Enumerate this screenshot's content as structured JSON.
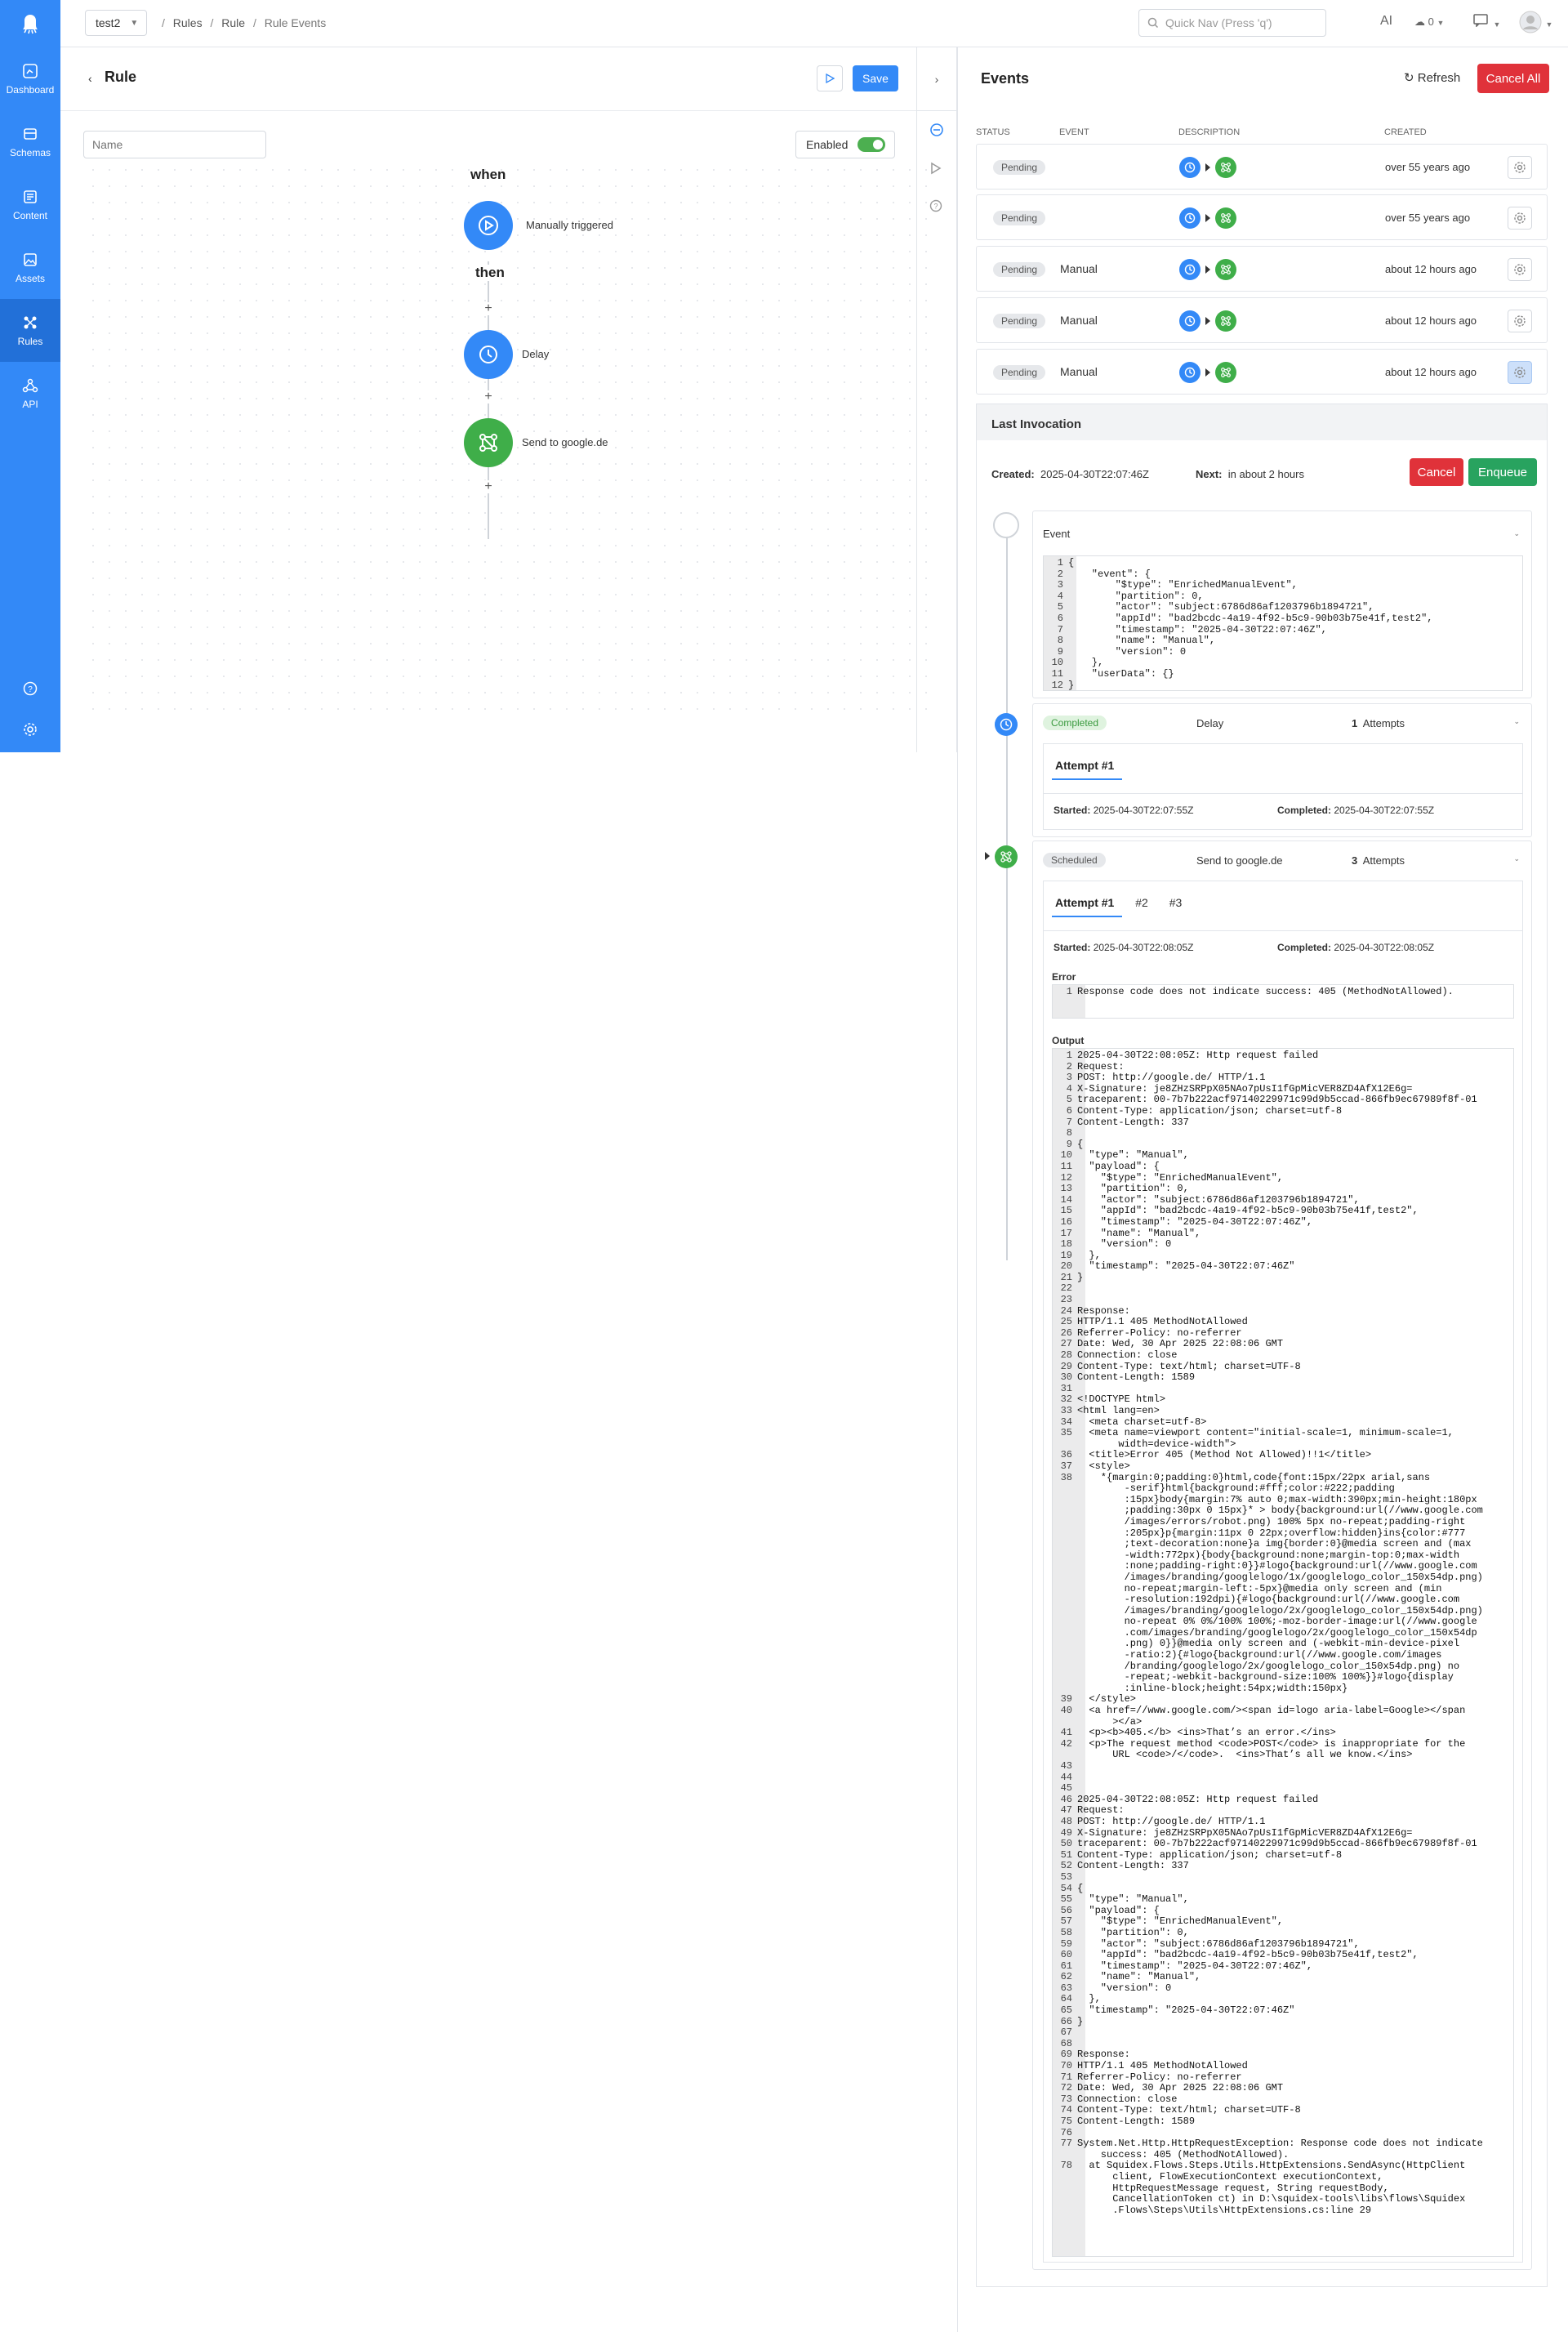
{
  "app": {
    "name": "test2"
  },
  "breadcrumb": [
    "Rules",
    "Rule",
    "Rule Events"
  ],
  "quicknav": {
    "placeholder": "Quick Nav (Press 'q')"
  },
  "topbar": {
    "ai_label": "AI",
    "upload_count": "0"
  },
  "nav": [
    {
      "label": "Dashboard"
    },
    {
      "label": "Schemas"
    },
    {
      "label": "Content"
    },
    {
      "label": "Assets"
    },
    {
      "label": "Rules"
    },
    {
      "label": "API"
    }
  ],
  "rule": {
    "title": "Rule",
    "save": "Save",
    "name_placeholder": "Name",
    "enabled_label": "Enabled",
    "when": "when",
    "then": "then",
    "trigger": "Manually triggered",
    "step1": "Delay",
    "step2": "Send to google.de",
    "plus": "+"
  },
  "events": {
    "title": "Events",
    "refresh": "Refresh",
    "cancel_all": "Cancel All",
    "columns": {
      "status": "STATUS",
      "event": "EVENT",
      "description": "DESCRIPTION",
      "created": "CREATED"
    },
    "rows": [
      {
        "status": "Pending",
        "event": "",
        "created": "over 55 years ago"
      },
      {
        "status": "Pending",
        "event": "",
        "created": "over 55 years ago"
      },
      {
        "status": "Pending",
        "event": "Manual",
        "created": "about 12 hours ago"
      },
      {
        "status": "Pending",
        "event": "Manual",
        "created": "about 12 hours ago"
      },
      {
        "status": "Pending",
        "event": "Manual",
        "created": "about 12 hours ago"
      }
    ]
  },
  "invocation": {
    "title": "Last Invocation",
    "created_label": "Created:",
    "created_value": "2025-04-30T22:07:46Z",
    "next_label": "Next:",
    "next_value": "in about 2 hours",
    "cancel": "Cancel",
    "enqueue": "Enqueue",
    "event_card_title": "Event",
    "event_json": [
      "{",
      "    \"event\": {",
      "        \"$type\": \"EnrichedManualEvent\",",
      "        \"partition\": 0,",
      "        \"actor\": \"subject:6786d86af1203796b1894721\",",
      "        \"appId\": \"bad2bcdc-4a19-4f92-b5c9-90b03b75e41f,test2\",",
      "        \"timestamp\": \"2025-04-30T22:07:46Z\",",
      "        \"name\": \"Manual\",",
      "        \"version\": 0",
      "    },",
      "    \"userData\": {}",
      "}"
    ],
    "step1": {
      "status": "Completed",
      "name": "Delay",
      "attempts_count": "1",
      "attempts_label": "Attempts",
      "tab": "Attempt  #1",
      "started_label": "Started:",
      "started": "2025-04-30T22:07:55Z",
      "completed_label": "Completed:",
      "completed": "2025-04-30T22:07:55Z"
    },
    "step2": {
      "status": "Scheduled",
      "name": "Send to google.de",
      "attempts_count": "3",
      "attempts_label": "Attempts",
      "tabs": [
        "Attempt  #1",
        "#2",
        "#3"
      ],
      "started_label": "Started:",
      "started": "2025-04-30T22:08:05Z",
      "completed_label": "Completed:",
      "completed": "2025-04-30T22:08:05Z",
      "error_label": "Error",
      "error": "Response code does not indicate success: 405 (MethodNotAllowed).",
      "output_label": "Output",
      "output": [
        [
          "1",
          "2025-04-30T22:08:05Z: Http request failed"
        ],
        [
          "2",
          "Request:"
        ],
        [
          "3",
          "POST: http://google.de/ HTTP/1.1"
        ],
        [
          "4",
          "X-Signature: je8ZHzSRPpX05NAo7pUsI1fGpMicVER8ZD4AfX12E6g="
        ],
        [
          "5",
          "traceparent: 00-7b7b222acf97140229971c99d9b5ccad-866fb9ec67989f8f-01"
        ],
        [
          "6",
          "Content-Type: application/json; charset=utf-8"
        ],
        [
          "7",
          "Content-Length: 337"
        ],
        [
          "8",
          ""
        ],
        [
          "9",
          "{"
        ],
        [
          "10",
          "  \"type\": \"Manual\","
        ],
        [
          "11",
          "  \"payload\": {"
        ],
        [
          "12",
          "    \"$type\": \"EnrichedManualEvent\","
        ],
        [
          "13",
          "    \"partition\": 0,"
        ],
        [
          "14",
          "    \"actor\": \"subject:6786d86af1203796b1894721\","
        ],
        [
          "15",
          "    \"appId\": \"bad2bcdc-4a19-4f92-b5c9-90b03b75e41f,test2\","
        ],
        [
          "16",
          "    \"timestamp\": \"2025-04-30T22:07:46Z\","
        ],
        [
          "17",
          "    \"name\": \"Manual\","
        ],
        [
          "18",
          "    \"version\": 0"
        ],
        [
          "19",
          "  },"
        ],
        [
          "20",
          "  \"timestamp\": \"2025-04-30T22:07:46Z\""
        ],
        [
          "21",
          "}"
        ],
        [
          "22",
          ""
        ],
        [
          "23",
          ""
        ],
        [
          "24",
          "Response:"
        ],
        [
          "25",
          "HTTP/1.1 405 MethodNotAllowed"
        ],
        [
          "26",
          "Referrer-Policy: no-referrer"
        ],
        [
          "27",
          "Date: Wed, 30 Apr 2025 22:08:06 GMT"
        ],
        [
          "28",
          "Connection: close"
        ],
        [
          "29",
          "Content-Type: text/html; charset=UTF-8"
        ],
        [
          "30",
          "Content-Length: 1589"
        ],
        [
          "31",
          ""
        ],
        [
          "32",
          "<!DOCTYPE html>"
        ],
        [
          "33",
          "<html lang=en>"
        ],
        [
          "34",
          "  <meta charset=utf-8>"
        ],
        [
          "35",
          "  <meta name=viewport content=\"initial-scale=1, minimum-scale=1,"
        ],
        [
          "",
          "       width=device-width\">"
        ],
        [
          "36",
          "  <title>Error 405 (Method Not Allowed)!!1</title>"
        ],
        [
          "37",
          "  <style>"
        ],
        [
          "38",
          "    *{margin:0;padding:0}html,code{font:15px/22px arial,sans"
        ],
        [
          "",
          "        -serif}html{background:#fff;color:#222;padding"
        ],
        [
          "",
          "        :15px}body{margin:7% auto 0;max-width:390px;min-height:180px"
        ],
        [
          "",
          "        ;padding:30px 0 15px}* > body{background:url(//www.google.com"
        ],
        [
          "",
          "        /images/errors/robot.png) 100% 5px no-repeat;padding-right"
        ],
        [
          "",
          "        :205px}p{margin:11px 0 22px;overflow:hidden}ins{color:#777"
        ],
        [
          "",
          "        ;text-decoration:none}a img{border:0}@media screen and (max"
        ],
        [
          "",
          "        -width:772px){body{background:none;margin-top:0;max-width"
        ],
        [
          "",
          "        :none;padding-right:0}}#logo{background:url(//www.google.com"
        ],
        [
          "",
          "        /images/branding/googlelogo/1x/googlelogo_color_150x54dp.png)"
        ],
        [
          "",
          "        no-repeat;margin-left:-5px}@media only screen and (min"
        ],
        [
          "",
          "        -resolution:192dpi){#logo{background:url(//www.google.com"
        ],
        [
          "",
          "        /images/branding/googlelogo/2x/googlelogo_color_150x54dp.png)"
        ],
        [
          "",
          "        no-repeat 0% 0%/100% 100%;-moz-border-image:url(//www.google"
        ],
        [
          "",
          "        .com/images/branding/googlelogo/2x/googlelogo_color_150x54dp"
        ],
        [
          "",
          "        .png) 0}}@media only screen and (-webkit-min-device-pixel"
        ],
        [
          "",
          "        -ratio:2){#logo{background:url(//www.google.com/images"
        ],
        [
          "",
          "        /branding/googlelogo/2x/googlelogo_color_150x54dp.png) no"
        ],
        [
          "",
          "        -repeat;-webkit-background-size:100% 100%}}#logo{display"
        ],
        [
          "",
          "        :inline-block;height:54px;width:150px}"
        ],
        [
          "39",
          "  </style>"
        ],
        [
          "40",
          "  <a href=//www.google.com/><span id=logo aria-label=Google></span"
        ],
        [
          "",
          "      ></a>"
        ],
        [
          "41",
          "  <p><b>405.</b> <ins>That’s an error.</ins>"
        ],
        [
          "42",
          "  <p>The request method <code>POST</code> is inappropriate for the"
        ],
        [
          "",
          "      URL <code>/</code>.  <ins>That’s all we know.</ins>"
        ],
        [
          "43",
          ""
        ],
        [
          "44",
          ""
        ],
        [
          "45",
          ""
        ],
        [
          "46",
          "2025-04-30T22:08:05Z: Http request failed"
        ],
        [
          "47",
          "Request:"
        ],
        [
          "48",
          "POST: http://google.de/ HTTP/1.1"
        ],
        [
          "49",
          "X-Signature: je8ZHzSRPpX05NAo7pUsI1fGpMicVER8ZD4AfX12E6g="
        ],
        [
          "50",
          "traceparent: 00-7b7b222acf97140229971c99d9b5ccad-866fb9ec67989f8f-01"
        ],
        [
          "51",
          "Content-Type: application/json; charset=utf-8"
        ],
        [
          "52",
          "Content-Length: 337"
        ],
        [
          "53",
          ""
        ],
        [
          "54",
          "{"
        ],
        [
          "55",
          "  \"type\": \"Manual\","
        ],
        [
          "56",
          "  \"payload\": {"
        ],
        [
          "57",
          "    \"$type\": \"EnrichedManualEvent\","
        ],
        [
          "58",
          "    \"partition\": 0,"
        ],
        [
          "59",
          "    \"actor\": \"subject:6786d86af1203796b1894721\","
        ],
        [
          "60",
          "    \"appId\": \"bad2bcdc-4a19-4f92-b5c9-90b03b75e41f,test2\","
        ],
        [
          "61",
          "    \"timestamp\": \"2025-04-30T22:07:46Z\","
        ],
        [
          "62",
          "    \"name\": \"Manual\","
        ],
        [
          "63",
          "    \"version\": 0"
        ],
        [
          "64",
          "  },"
        ],
        [
          "65",
          "  \"timestamp\": \"2025-04-30T22:07:46Z\""
        ],
        [
          "66",
          "}"
        ],
        [
          "67",
          ""
        ],
        [
          "68",
          ""
        ],
        [
          "69",
          "Response:"
        ],
        [
          "70",
          "HTTP/1.1 405 MethodNotAllowed"
        ],
        [
          "71",
          "Referrer-Policy: no-referrer"
        ],
        [
          "72",
          "Date: Wed, 30 Apr 2025 22:08:06 GMT"
        ],
        [
          "73",
          "Connection: close"
        ],
        [
          "74",
          "Content-Type: text/html; charset=UTF-8"
        ],
        [
          "75",
          "Content-Length: 1589"
        ],
        [
          "76",
          ""
        ],
        [
          "77",
          "System.Net.Http.HttpRequestException: Response code does not indicate"
        ],
        [
          "",
          "    success: 405 (MethodNotAllowed)."
        ],
        [
          "78",
          "  at Squidex.Flows.Steps.Utils.HttpExtensions.SendAsync(HttpClient"
        ],
        [
          "",
          "      client, FlowExecutionContext executionContext,"
        ],
        [
          "",
          "      HttpRequestMessage request, String requestBody,"
        ],
        [
          "",
          "      CancellationToken ct) in D:\\squidex-tools\\libs\\flows\\Squidex"
        ],
        [
          "",
          "      .Flows\\Steps\\Utils\\HttpExtensions.cs:line 29"
        ]
      ]
    }
  }
}
